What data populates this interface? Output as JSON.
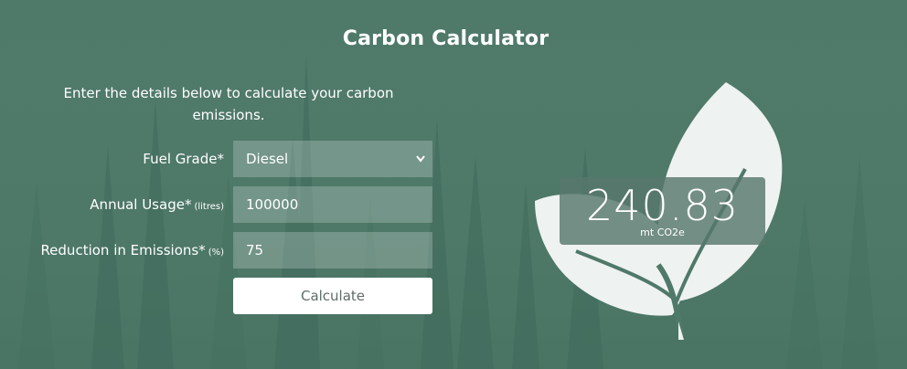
{
  "header": {
    "title": "Carbon Calculator"
  },
  "intro": {
    "text": "Enter the details below to calculate your carbon emissions."
  },
  "form": {
    "fuel_grade": {
      "label": "Fuel Grade*",
      "value": "Diesel"
    },
    "annual_usage": {
      "label": "Annual Usage*",
      "unit": "(litres)",
      "value": "100000"
    },
    "reduction": {
      "label": "Reduction in Emissions*",
      "unit": "(%)",
      "value": "75"
    },
    "calculate_label": "Calculate"
  },
  "result": {
    "value": "240.83",
    "unit": "mt CO2e"
  },
  "icons": {
    "select_arrow": "chevron-down-icon",
    "leaf": "leaf-icon"
  },
  "colors": {
    "background": "#4e7868",
    "leaf": "#eef2f0",
    "result_box": "#58786c",
    "button": "#ffffff"
  }
}
